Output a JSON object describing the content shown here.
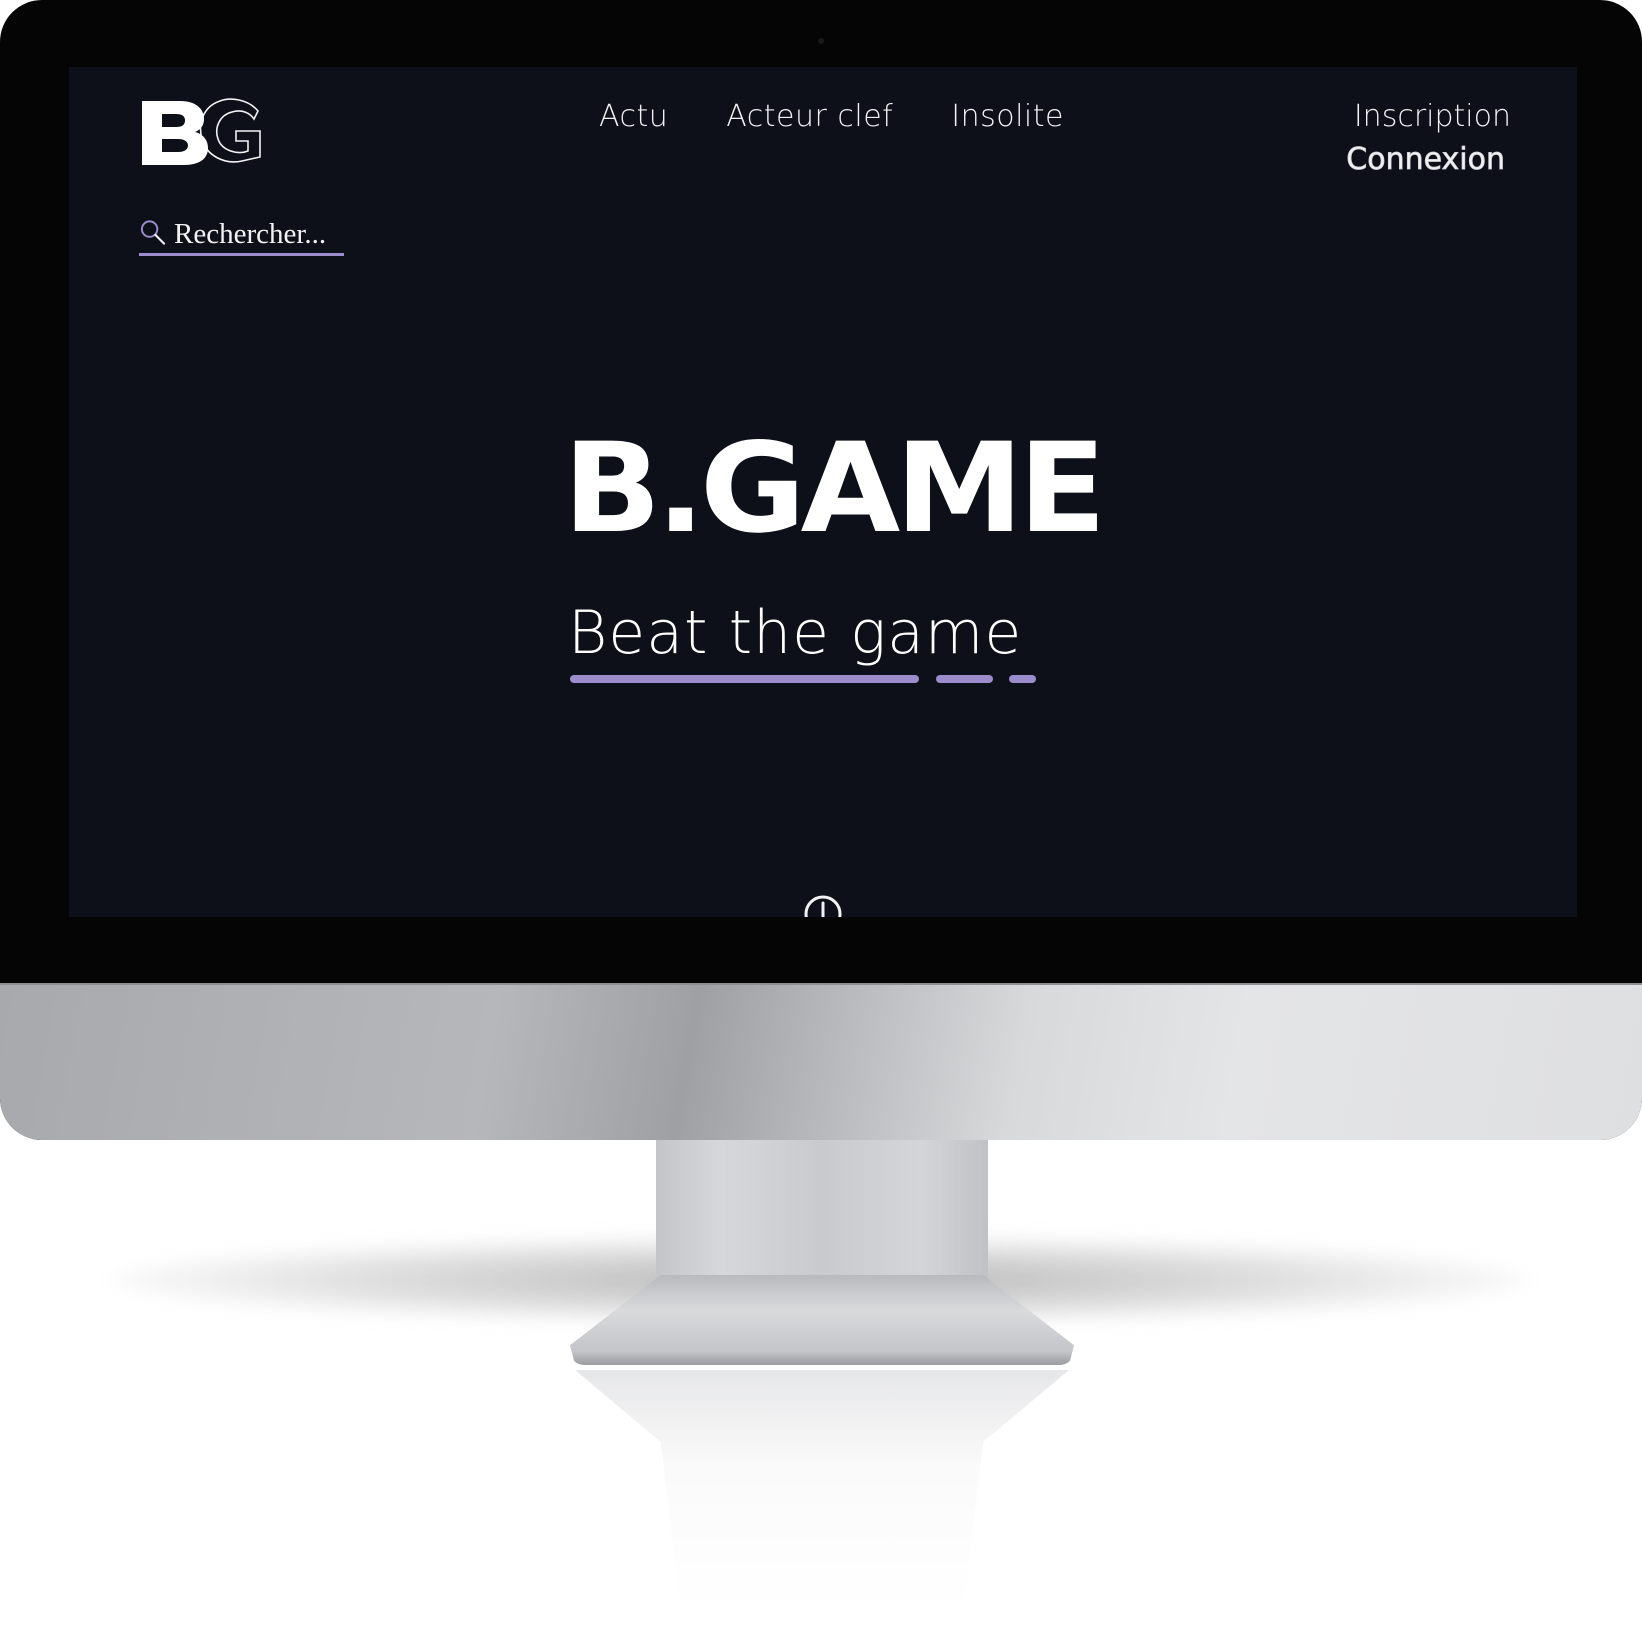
{
  "brand": {
    "logo_text": "BG",
    "title": "B.GAME",
    "tagline": "Beat the game",
    "accent_color": "#9b8ccc",
    "background_color": "#0e1019"
  },
  "nav": {
    "items": [
      {
        "label": "Actu"
      },
      {
        "label": "Acteur clef"
      },
      {
        "label": "Insolite"
      }
    ]
  },
  "auth": {
    "register_label": "Inscription",
    "login_label": "Connexion"
  },
  "search": {
    "placeholder": "Rechercher...",
    "icon": "search-icon"
  },
  "scroll": {
    "icon": "scroll-down-icon"
  }
}
